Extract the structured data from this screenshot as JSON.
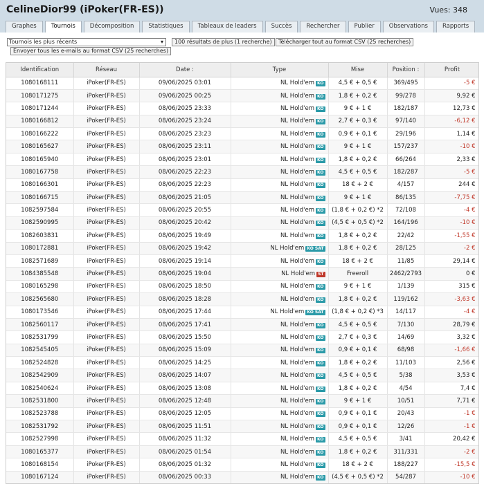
{
  "header": {
    "title": "CelineDior99 (iPoker(FR-ES))",
    "views": "Vues: 348"
  },
  "tabs": [
    {
      "label": "Graphes",
      "active": false
    },
    {
      "label": "Tournois",
      "active": true
    },
    {
      "label": "Décomposition",
      "active": false
    },
    {
      "label": "Statistiques",
      "active": false
    },
    {
      "label": "Tableaux de leaders",
      "active": false
    },
    {
      "label": "Succès",
      "active": false
    },
    {
      "label": "Rechercher",
      "active": false
    },
    {
      "label": "Publier",
      "active": false
    },
    {
      "label": "Observations",
      "active": false
    },
    {
      "label": "Rapports",
      "active": false
    }
  ],
  "controls": {
    "select_value": "Tournois les plus récents",
    "more_button": "100 résultats de plus (1 recherche)",
    "csv_button": "Télécharger tout au format CSV (25 recherches)",
    "email_button": "Envoyer tous les e-mails au format CSV (25 recherches)"
  },
  "table": {
    "headers": [
      "Identification",
      "Réseau",
      "Date :",
      "Type",
      "Mise",
      "Position :",
      "Profit"
    ],
    "rows": [
      {
        "id": "1080168111",
        "network": "iPoker(FR-ES)",
        "date": "09/06/2025 03:01",
        "type": "NL Hold'em",
        "badge": "KO",
        "stake": "4,5 € + 0,5 €",
        "position": "369/495",
        "profit": "-5 €",
        "neg": true
      },
      {
        "id": "1080171275",
        "network": "iPoker(FR-ES)",
        "date": "09/06/2025 00:25",
        "type": "NL Hold'em",
        "badge": "KO",
        "stake": "1,8 € + 0,2 €",
        "position": "99/278",
        "profit": "9,92 €",
        "neg": false
      },
      {
        "id": "1080171244",
        "network": "iPoker(FR-ES)",
        "date": "08/06/2025 23:33",
        "type": "NL Hold'em",
        "badge": "KO",
        "stake": "9 € + 1 €",
        "position": "182/187",
        "profit": "12,73 €",
        "neg": false
      },
      {
        "id": "1080166812",
        "network": "iPoker(FR-ES)",
        "date": "08/06/2025 23:24",
        "type": "NL Hold'em",
        "badge": "KO",
        "stake": "2,7 € + 0,3 €",
        "position": "97/140",
        "profit": "-6,12 €",
        "neg": true
      },
      {
        "id": "1080166222",
        "network": "iPoker(FR-ES)",
        "date": "08/06/2025 23:23",
        "type": "NL Hold'em",
        "badge": "KO",
        "stake": "0,9 € + 0,1 €",
        "position": "29/196",
        "profit": "1,14 €",
        "neg": false
      },
      {
        "id": "1080165627",
        "network": "iPoker(FR-ES)",
        "date": "08/06/2025 23:11",
        "type": "NL Hold'em",
        "badge": "KO",
        "stake": "9 € + 1 €",
        "position": "157/237",
        "profit": "-10 €",
        "neg": true
      },
      {
        "id": "1080165940",
        "network": "iPoker(FR-ES)",
        "date": "08/06/2025 23:01",
        "type": "NL Hold'em",
        "badge": "KO",
        "stake": "1,8 € + 0,2 €",
        "position": "66/264",
        "profit": "2,33 €",
        "neg": false
      },
      {
        "id": "1080167758",
        "network": "iPoker(FR-ES)",
        "date": "08/06/2025 22:23",
        "type": "NL Hold'em",
        "badge": "KO",
        "stake": "4,5 € + 0,5 €",
        "position": "182/287",
        "profit": "-5 €",
        "neg": true
      },
      {
        "id": "1080166301",
        "network": "iPoker(FR-ES)",
        "date": "08/06/2025 22:23",
        "type": "NL Hold'em",
        "badge": "KO",
        "stake": "18 € + 2 €",
        "position": "4/157",
        "profit": "244 €",
        "neg": false
      },
      {
        "id": "1080166715",
        "network": "iPoker(FR-ES)",
        "date": "08/06/2025 21:05",
        "type": "NL Hold'em",
        "badge": "KO",
        "stake": "9 € + 1 €",
        "position": "86/135",
        "profit": "-7,75 €",
        "neg": true
      },
      {
        "id": "1082597584",
        "network": "iPoker(FR-ES)",
        "date": "08/06/2025 20:55",
        "type": "NL Hold'em",
        "badge": "KO",
        "stake": "(1,8 € + 0,2 €) *2",
        "position": "72/108",
        "profit": "-4 €",
        "neg": true
      },
      {
        "id": "1082590995",
        "network": "iPoker(FR-ES)",
        "date": "08/06/2025 20:42",
        "type": "NL Hold'em",
        "badge": "KO",
        "stake": "(4,5 € + 0,5 €) *2",
        "position": "164/196",
        "profit": "-10 €",
        "neg": true
      },
      {
        "id": "1082603831",
        "network": "iPoker(FR-ES)",
        "date": "08/06/2025 19:49",
        "type": "NL Hold'em",
        "badge": "KO",
        "stake": "1,8 € + 0,2 €",
        "position": "22/42",
        "profit": "-1,55 €",
        "neg": true
      },
      {
        "id": "1080172881",
        "network": "iPoker(FR-ES)",
        "date": "08/06/2025 19:42",
        "type": "NL Hold'em",
        "badge": "KO SAT",
        "stake": "1,8 € + 0,2 €",
        "position": "28/125",
        "profit": "-2 €",
        "neg": true
      },
      {
        "id": "1082571689",
        "network": "iPoker(FR-ES)",
        "date": "08/06/2025 19:14",
        "type": "NL Hold'em",
        "badge": "KO",
        "stake": "18 € + 2 €",
        "position": "11/85",
        "profit": "29,14 €",
        "neg": false
      },
      {
        "id": "1084385548",
        "network": "iPoker(FR-ES)",
        "date": "08/06/2025 19:04",
        "type": "NL Hold'em",
        "badge": "ST",
        "stake": "Freeroll",
        "position": "2462/2793",
        "profit": "0 €",
        "neg": false
      },
      {
        "id": "1080165298",
        "network": "iPoker(FR-ES)",
        "date": "08/06/2025 18:50",
        "type": "NL Hold'em",
        "badge": "KO",
        "stake": "9 € + 1 €",
        "position": "1/139",
        "profit": "315 €",
        "neg": false
      },
      {
        "id": "1082565680",
        "network": "iPoker(FR-ES)",
        "date": "08/06/2025 18:28",
        "type": "NL Hold'em",
        "badge": "KO",
        "stake": "1,8 € + 0,2 €",
        "position": "119/162",
        "profit": "-3,63 €",
        "neg": true
      },
      {
        "id": "1080173546",
        "network": "iPoker(FR-ES)",
        "date": "08/06/2025 17:44",
        "type": "NL Hold'em",
        "badge": "KO SAT",
        "stake": "(1,8 € + 0,2 €) *3",
        "position": "14/117",
        "profit": "-4 €",
        "neg": true
      },
      {
        "id": "1082560117",
        "network": "iPoker(FR-ES)",
        "date": "08/06/2025 17:41",
        "type": "NL Hold'em",
        "badge": "KO",
        "stake": "4,5 € + 0,5 €",
        "position": "7/130",
        "profit": "28,79 €",
        "neg": false
      },
      {
        "id": "1082531799",
        "network": "iPoker(FR-ES)",
        "date": "08/06/2025 15:50",
        "type": "NL Hold'em",
        "badge": "KO",
        "stake": "2,7 € + 0,3 €",
        "position": "14/69",
        "profit": "3,32 €",
        "neg": false
      },
      {
        "id": "1082545405",
        "network": "iPoker(FR-ES)",
        "date": "08/06/2025 15:09",
        "type": "NL Hold'em",
        "badge": "KO",
        "stake": "0,9 € + 0,1 €",
        "position": "68/98",
        "profit": "-1,66 €",
        "neg": true
      },
      {
        "id": "1082524828",
        "network": "iPoker(FR-ES)",
        "date": "08/06/2025 14:25",
        "type": "NL Hold'em",
        "badge": "KO",
        "stake": "1,8 € + 0,2 €",
        "position": "11/103",
        "profit": "2,56 €",
        "neg": false
      },
      {
        "id": "1082542909",
        "network": "iPoker(FR-ES)",
        "date": "08/06/2025 14:07",
        "type": "NL Hold'em",
        "badge": "KO",
        "stake": "4,5 € + 0,5 €",
        "position": "5/38",
        "profit": "3,53 €",
        "neg": false
      },
      {
        "id": "1082540624",
        "network": "iPoker(FR-ES)",
        "date": "08/06/2025 13:08",
        "type": "NL Hold'em",
        "badge": "KO",
        "stake": "1,8 € + 0,2 €",
        "position": "4/54",
        "profit": "7,4 €",
        "neg": false
      },
      {
        "id": "1082531800",
        "network": "iPoker(FR-ES)",
        "date": "08/06/2025 12:48",
        "type": "NL Hold'em",
        "badge": "KO",
        "stake": "9 € + 1 €",
        "position": "10/51",
        "profit": "7,71 €",
        "neg": false
      },
      {
        "id": "1082523788",
        "network": "iPoker(FR-ES)",
        "date": "08/06/2025 12:05",
        "type": "NL Hold'em",
        "badge": "KO",
        "stake": "0,9 € + 0,1 €",
        "position": "20/43",
        "profit": "-1 €",
        "neg": true
      },
      {
        "id": "1082531792",
        "network": "iPoker(FR-ES)",
        "date": "08/06/2025 11:51",
        "type": "NL Hold'em",
        "badge": "KO",
        "stake": "0,9 € + 0,1 €",
        "position": "12/26",
        "profit": "-1 €",
        "neg": true
      },
      {
        "id": "1082527998",
        "network": "iPoker(FR-ES)",
        "date": "08/06/2025 11:32",
        "type": "NL Hold'em",
        "badge": "KO",
        "stake": "4,5 € + 0,5 €",
        "position": "3/41",
        "profit": "20,42 €",
        "neg": false
      },
      {
        "id": "1080165377",
        "network": "iPoker(FR-ES)",
        "date": "08/06/2025 01:54",
        "type": "NL Hold'em",
        "badge": "KO",
        "stake": "1,8 € + 0,2 €",
        "position": "311/331",
        "profit": "-2 €",
        "neg": true
      },
      {
        "id": "1080168154",
        "network": "iPoker(FR-ES)",
        "date": "08/06/2025 01:32",
        "type": "NL Hold'em",
        "badge": "KO",
        "stake": "18 € + 2 €",
        "position": "188/227",
        "profit": "-15,5 €",
        "neg": true
      },
      {
        "id": "1080167124",
        "network": "iPoker(FR-ES)",
        "date": "08/06/2025 00:33",
        "type": "NL Hold'em",
        "badge": "KO",
        "stake": "(4,5 € + 0,5 €) *2",
        "position": "54/287",
        "profit": "-10 €",
        "neg": true
      }
    ]
  }
}
